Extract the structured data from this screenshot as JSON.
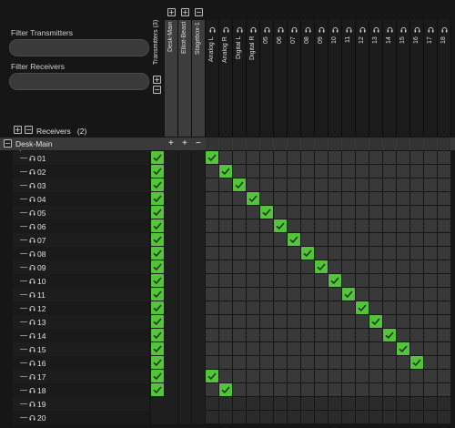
{
  "filters": {
    "transmitters_label": "Filter Transmitters",
    "transmitters_value": "",
    "receivers_label": "Filter Receivers",
    "receivers_value": ""
  },
  "header": {
    "transmitters_label": "Transmitters",
    "transmitters_count": "(3)",
    "receivers_label": "Receivers",
    "receivers_count": "(2)"
  },
  "transmitter_devices": [
    "Desk-Main",
    "Elliot-Beast",
    "Stagebox-1"
  ],
  "channels": [
    "Analog L",
    "Analog R",
    "Digital L",
    "Digital R",
    "05",
    "06",
    "07",
    "08",
    "09",
    "10",
    "11",
    "12",
    "13",
    "14",
    "15",
    "16",
    "17",
    "18"
  ],
  "receiver_device": "Desk-Main",
  "group_row_symbols": [
    "+",
    "+",
    "−"
  ],
  "receiver_channels": [
    "01",
    "02",
    "03",
    "04",
    "05",
    "06",
    "07",
    "08",
    "09",
    "10",
    "11",
    "12",
    "13",
    "14",
    "15",
    "16",
    "17",
    "18",
    "19",
    "20"
  ],
  "subscriptions": [
    {
      "row": 0,
      "col": 0
    },
    {
      "row": 1,
      "col": 1
    },
    {
      "row": 2,
      "col": 2
    },
    {
      "row": 3,
      "col": 3
    },
    {
      "row": 4,
      "col": 4
    },
    {
      "row": 5,
      "col": 5
    },
    {
      "row": 6,
      "col": 6
    },
    {
      "row": 7,
      "col": 7
    },
    {
      "row": 8,
      "col": 8
    },
    {
      "row": 9,
      "col": 9
    },
    {
      "row": 10,
      "col": 10
    },
    {
      "row": 11,
      "col": 11
    },
    {
      "row": 12,
      "col": 12
    },
    {
      "row": 13,
      "col": 13
    },
    {
      "row": 14,
      "col": 14
    },
    {
      "row": 15,
      "col": 15
    },
    {
      "row": 16,
      "col": 0
    },
    {
      "row": 17,
      "col": 1
    }
  ],
  "receiver_status_checked": 18,
  "colors": {
    "check": "#55c43c",
    "group_bg": "#3a3a3a"
  },
  "icons": {
    "channel": "headphones-icon",
    "expand": "plus-box-icon",
    "collapse": "minus-box-icon"
  }
}
